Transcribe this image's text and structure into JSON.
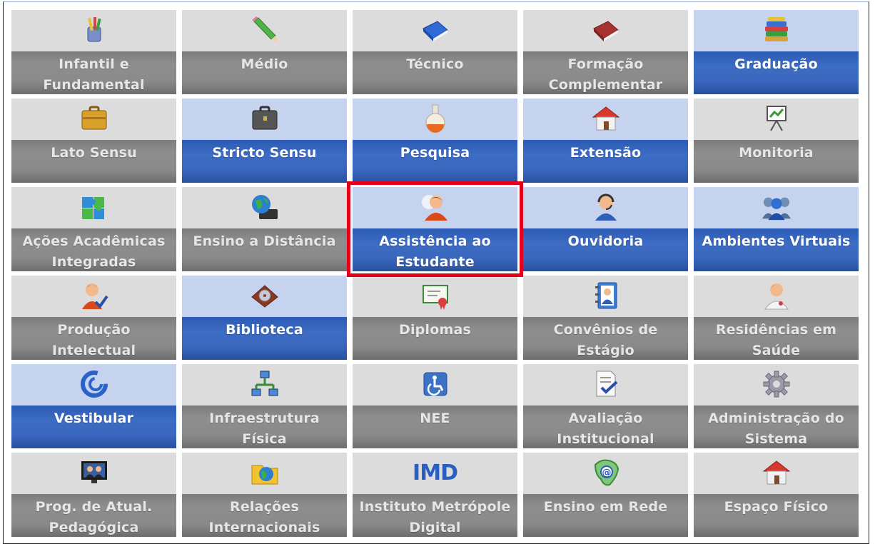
{
  "menu": {
    "tiles": [
      {
        "label": "Infantil e\nFundamental",
        "icon": "pencil-cup-icon",
        "state": "normal"
      },
      {
        "label": "Médio",
        "icon": "pencil-icon",
        "state": "normal"
      },
      {
        "label": "Técnico",
        "icon": "blue-book-icon",
        "state": "normal"
      },
      {
        "label": "Formação\nComplementar",
        "icon": "red-book-icon",
        "state": "normal"
      },
      {
        "label": "Graduação",
        "icon": "book-stack-icon",
        "state": "selected"
      },
      {
        "label": "Lato Sensu",
        "icon": "briefcase-icon",
        "state": "normal"
      },
      {
        "label": "Stricto Sensu",
        "icon": "dark-briefcase-icon",
        "state": "selected"
      },
      {
        "label": "Pesquisa",
        "icon": "flask-icon",
        "state": "selected"
      },
      {
        "label": "Extensão",
        "icon": "house-icon",
        "state": "selected"
      },
      {
        "label": "Monitoria",
        "icon": "presentation-board-icon",
        "state": "normal"
      },
      {
        "label": "Ações Acadêmicas\nIntegradas",
        "icon": "puzzle-icon",
        "state": "normal"
      },
      {
        "label": "Ensino a Distância",
        "icon": "globe-keyboard-icon",
        "state": "normal"
      },
      {
        "label": "Assistência ao\nEstudante",
        "icon": "student-user-icon",
        "state": "selected",
        "highlighted": true
      },
      {
        "label": "Ouvidoria",
        "icon": "headset-user-icon",
        "state": "selected"
      },
      {
        "label": "Ambientes Virtuais",
        "icon": "user-group-icon",
        "state": "selected"
      },
      {
        "label": "Produção\nIntelectual",
        "icon": "user-check-icon",
        "state": "normal"
      },
      {
        "label": "Biblioteca",
        "icon": "disc-book-icon",
        "state": "selected"
      },
      {
        "label": "Diplomas",
        "icon": "certificate-icon",
        "state": "normal"
      },
      {
        "label": "Convênios de\nEstágio",
        "icon": "contact-book-icon",
        "state": "normal"
      },
      {
        "label": "Residências em\nSaúde",
        "icon": "doctor-icon",
        "state": "normal"
      },
      {
        "label": "Vestibular",
        "icon": "vestibular-logo-icon",
        "state": "selected"
      },
      {
        "label": "Infraestrutura\nFísica",
        "icon": "network-icon",
        "state": "normal"
      },
      {
        "label": "NEE",
        "icon": "accessibility-icon",
        "state": "normal"
      },
      {
        "label": "Avaliação\nInstitucional",
        "icon": "document-check-icon",
        "state": "normal"
      },
      {
        "label": "Administração do\nSistema",
        "icon": "gear-icon",
        "state": "normal"
      },
      {
        "label": "Prog. de Atual.\nPedagógica",
        "icon": "monitor-people-icon",
        "state": "normal"
      },
      {
        "label": "Relações\nInternacionais",
        "icon": "globe-folder-icon",
        "state": "normal"
      },
      {
        "label": "Instituto Metrópole\nDigital",
        "icon": "imd-logo-icon",
        "state": "normal",
        "logo_text": "IMD"
      },
      {
        "label": "Ensino em Rede",
        "icon": "brazil-map-at-icon",
        "state": "normal"
      },
      {
        "label": "Espaço Físico",
        "icon": "house-icon",
        "state": "normal"
      }
    ]
  },
  "colors": {
    "tile_top": "#dcdcdc",
    "tile_band": "#8a8a8a",
    "selected_top": "#c5d3ee",
    "selected_band": "#3a67bd",
    "highlight": "#e4001b"
  }
}
